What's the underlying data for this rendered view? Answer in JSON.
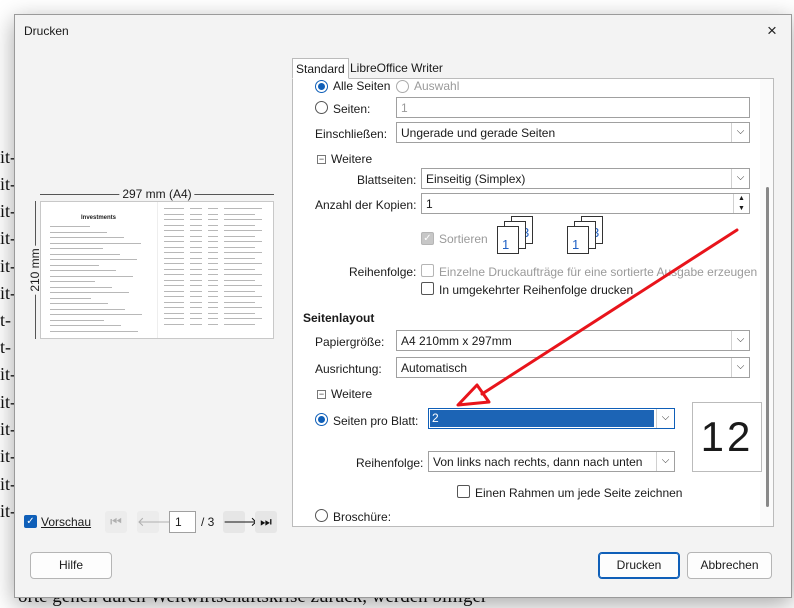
{
  "background": {
    "line_fragments": [
      "it-",
      "it-",
      "it-",
      "it-",
      "it-",
      "it-",
      "t-",
      "t-",
      "it-",
      "it-",
      "it-",
      "it-",
      "it-",
      "it-"
    ],
    "bottom_text": "orte gehen durch Weltwirtschaftskrise zurück, werden billiger"
  },
  "dialog": {
    "title": "Drucken",
    "close_icon": "×"
  },
  "preview": {
    "width_label": "297 mm (A4)",
    "height_label": "210 mm",
    "page_title": "Investments",
    "vorschau_label": "Vorschau",
    "current_page": "1",
    "total_pages": "/ 3"
  },
  "tabs": [
    {
      "label": "Standard"
    },
    {
      "label": "LibreOffice Writer"
    }
  ],
  "range": {
    "alle_seiten": "Alle Seiten",
    "auswahl": "Auswahl",
    "seiten": "Seiten:",
    "seiten_value": "1",
    "einschliessen_label": "Einschließen:",
    "einschliessen_value": "Ungerade und gerade Seiten"
  },
  "weitere1": {
    "label": "Weitere",
    "blattseiten_label": "Blattseiten:",
    "blattseiten_value": "Einseitig (Simplex)",
    "kopien_label": "Anzahl der Kopien:",
    "kopien_value": "1",
    "sortieren_label": "Sortieren",
    "reihenfolge_label": "Reihenfolge:",
    "einzelne_label": "Einzelne Druckaufträge für eine sortierte Ausgabe erzeugen",
    "umgekehrt_label": "In umgekehrter Reihenfolge drucken"
  },
  "seitenlayout": {
    "heading": "Seitenlayout",
    "papier_label": "Papiergröße:",
    "papier_value": "A4 210mm x 297mm",
    "ausrichtung_label": "Ausrichtung:",
    "ausrichtung_value": "Automatisch"
  },
  "weitere2": {
    "label": "Weitere",
    "seiten_pro_blatt_label": "Seiten pro Blatt:",
    "seiten_pro_blatt_value": "2",
    "reihenfolge_label": "Reihenfolge:",
    "reihenfolge_value": "Von links nach rechts, dann nach unten",
    "rahmen_label": "Einen Rahmen um jede Seite zeichnen",
    "broschure_label": "Broschüre:",
    "preview_number": "12"
  },
  "buttons": {
    "hilfe": "Hilfe",
    "drucken": "Drucken",
    "abbrechen": "Abbrechen"
  },
  "colors": {
    "accent": "#0f5fb8",
    "annotation_arrow": "#e8141b"
  }
}
